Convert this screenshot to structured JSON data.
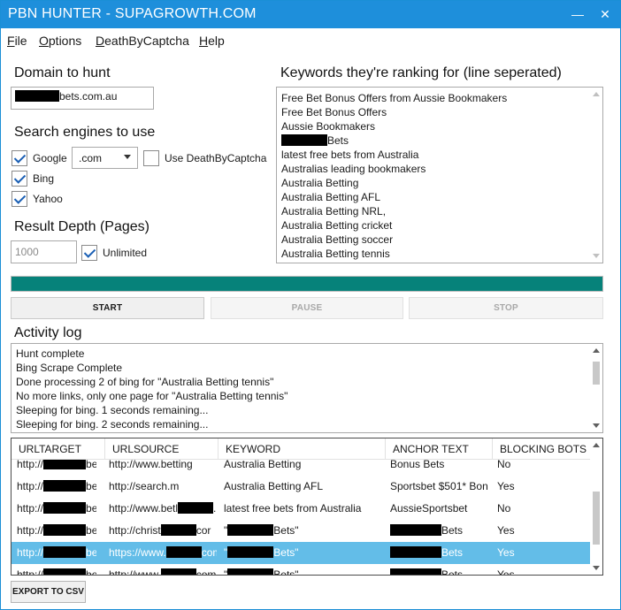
{
  "window": {
    "title": "PBN HUNTER - SUPAGROWTH.COM",
    "minimize": "—",
    "close": "✕"
  },
  "menu": [
    {
      "first": "F",
      "rest": "ile"
    },
    {
      "first": "O",
      "rest": "ptions"
    },
    {
      "first": "D",
      "rest": "eathByCaptcha"
    },
    {
      "first": "H",
      "rest": "elp"
    }
  ],
  "domain": {
    "label": "Domain to hunt",
    "value_suffix": "bets.com.au"
  },
  "engines": {
    "label": "Search engines to use",
    "google": {
      "label": "Google",
      "checked": true
    },
    "tld": ".com",
    "dbc": {
      "label": "Use DeathByCaptcha",
      "checked": false
    },
    "bing": {
      "label": "Bing",
      "checked": true
    },
    "yahoo": {
      "label": "Yahoo",
      "checked": true
    }
  },
  "depth": {
    "label": "Result Depth (Pages)",
    "value": "1000",
    "unlimited": {
      "label": "Unlimited",
      "checked": true
    }
  },
  "keywords": {
    "label": "Keywords they're ranking for (line seperated)",
    "lines": [
      "Free Bet Bonus Offers from Aussie Bookmakers",
      "Free Bet Bonus Offers",
      "Aussie Bookmakers",
      "Bets",
      "latest free bets from Australia",
      "Australias leading bookmakers",
      "Australia Betting",
      "Australia Betting AFL",
      "Australia Betting NRL,",
      "Australia Betting cricket",
      "Australia Betting soccer",
      "Australia Betting tennis"
    ]
  },
  "progress": {
    "percent": 100,
    "color": "#06827a"
  },
  "buttons": {
    "start": "START",
    "pause": "PAUSE",
    "stop": "STOP",
    "export": "EXPORT TO CSV"
  },
  "activity": {
    "label": "Activity log",
    "lines": [
      "Hunt complete",
      "Bing Scrape Complete",
      "Done processing 2 of bing for \"Australia Betting tennis\"",
      "No more links, only one page for \"Australia Betting tennis\"",
      "Sleeping for bing. 1 seconds remaining...",
      "Sleeping for bing. 2 seconds remaining..."
    ]
  },
  "table": {
    "columns": [
      "URLTARGET",
      "URLSOURCE",
      "KEYWORD",
      "ANCHOR TEXT",
      "BLOCKING BOTS"
    ],
    "rows": [
      {
        "target": "http://",
        "target_end": "be",
        "source": "http://www.betting",
        "keyword": "Australia Betting",
        "anchor": "Bonus Bets",
        "blocking": "No",
        "selected": false
      },
      {
        "target": "http://",
        "target_end": "be",
        "source": "http://search.m",
        "keyword": "Australia Betting AFL",
        "anchor": "Sportsbet $501* Bon",
        "blocking": "Yes",
        "selected": false
      },
      {
        "target": "http://",
        "target_end": "be",
        "source": "http://www.betl",
        "source_end": ".biz",
        "keyword": "latest free bets from Australia",
        "anchor": "AussieSportsbet",
        "blocking": "No",
        "selected": false
      },
      {
        "target": "http://",
        "target_end": "be",
        "source": "http://christ",
        "source_end": "cor",
        "keyword": "\"",
        "keyword_end": "Bets\"",
        "anchor": "Bets",
        "blocking": "Yes",
        "selected": false
      },
      {
        "target": "http://",
        "target_end": "be",
        "source": "https://www.",
        "source_end": "com.",
        "keyword": "\"",
        "keyword_end": "Bets\"",
        "anchor": "Bets",
        "blocking": "Yes",
        "selected": true
      },
      {
        "target": "http://",
        "target_end": "be",
        "source": "http://www.",
        "source_end": "com",
        "keyword": "\"",
        "keyword_end": "Bets\"",
        "anchor": "Bets",
        "blocking": "Yes",
        "selected": false
      }
    ]
  }
}
